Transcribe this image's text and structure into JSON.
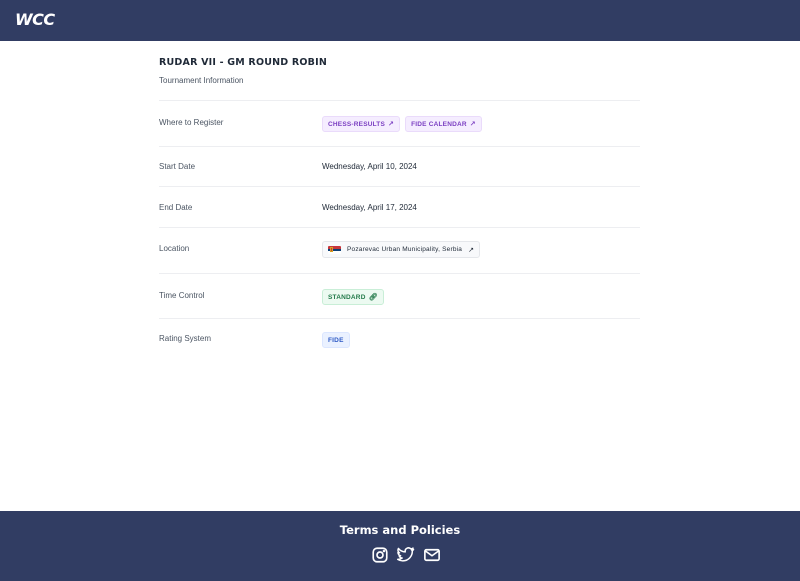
{
  "header": {
    "logo": "WCC"
  },
  "tournament": {
    "title": "RUDAR VII - GM ROUND ROBIN",
    "subtitle": "Tournament Information"
  },
  "rows": {
    "register": {
      "label": "Where to Register",
      "links": [
        "CHESS-RESULTS",
        "FIDE CALENDAR"
      ]
    },
    "start": {
      "label": "Start Date",
      "value": "Wednesday, April 10, 2024"
    },
    "end": {
      "label": "End Date",
      "value": "Wednesday, April 17, 2024"
    },
    "location": {
      "label": "Location",
      "value": "Pozarevac Urban Municipality, Serbia",
      "flag_icon": "serbia-flag-icon"
    },
    "time_control": {
      "label": "Time Control",
      "value": "STANDARD"
    },
    "rating": {
      "label": "Rating System",
      "value": "FIDE"
    }
  },
  "footer": {
    "title": "Terms and Policies",
    "social_icons": [
      "instagram-icon",
      "twitter-icon",
      "mail-icon"
    ]
  },
  "colors": {
    "navy": "#313d63",
    "purple_badge": "#7b3fc2",
    "green_badge": "#237a4a",
    "blue_badge": "#2b58c4"
  }
}
